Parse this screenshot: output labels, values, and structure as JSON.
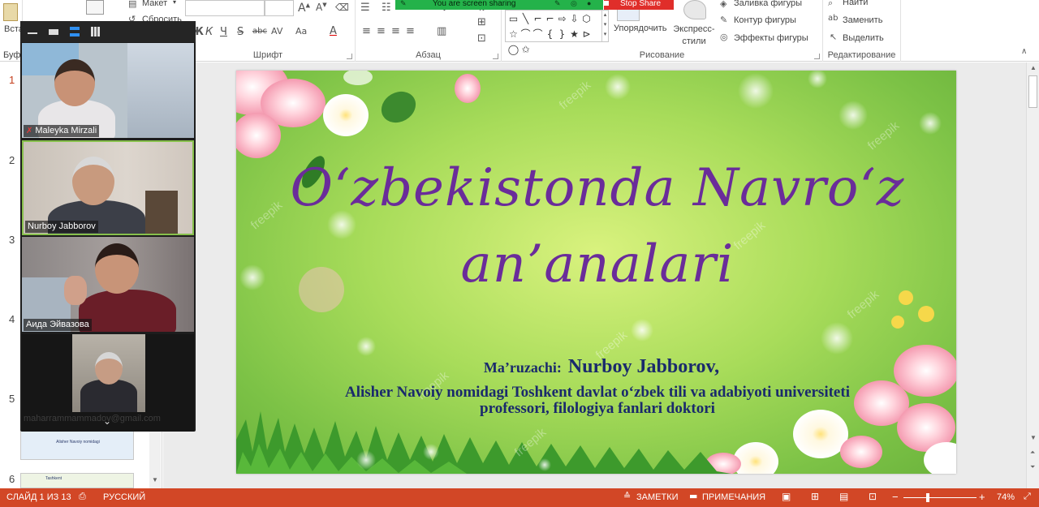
{
  "ribbon": {
    "clipboard": {
      "paste_label": "Вста",
      "group_label": "Буфе"
    },
    "slides": {
      "layout_label": "Макет",
      "reset_label": "Сбросить"
    },
    "font": {
      "group_label": "Шрифт",
      "buttons": [
        "Ж",
        "К",
        "Ч",
        "S",
        "abc",
        "AV",
        "Aa",
        "A"
      ]
    },
    "paragraph": {
      "group_label": "Абзац"
    },
    "drawing": {
      "group_label": "Рисование",
      "arrange_label": "Упорядочить",
      "quick_styles_label": "Экспресс-стили",
      "shape_fill_label": "Заливка фигуры",
      "shape_outline_label": "Контур фигуры",
      "shape_effects_label": "Эффекты фигуры",
      "shape_glyphs": [
        "▭",
        "╲",
        "⌐",
        "⌐",
        "⇨",
        "⇩",
        "⬡",
        "☆",
        "⌒",
        "⌒",
        "{",
        "}",
        "★",
        "⊳",
        "◯",
        "✩"
      ]
    },
    "editing": {
      "group_label": "Редактирование",
      "find_label": "Найти",
      "replace_label": "Заменить",
      "select_label": "Выделить"
    }
  },
  "share": {
    "status_text": "You are screen sharing",
    "stop_label": "Stop Share"
  },
  "thumbnails": {
    "numbers": [
      "1",
      "2",
      "3",
      "4",
      "5",
      "6"
    ],
    "thumb_texts": [
      "Alisher Navoiy nomidagi",
      "Tashkent"
    ]
  },
  "zoom": {
    "participants": [
      {
        "name": "Maleyka Mirzali",
        "muted": true
      },
      {
        "name": "Nurboy Jabborov",
        "muted": false
      },
      {
        "name": "Аида Эйвазова",
        "muted": false
      },
      {
        "name": "maharrammammadov@gmail.com",
        "muted": false
      }
    ]
  },
  "slide": {
    "title": "O‘zbekistonda  Navro‘z an’analari",
    "speaker_label": "Ma’ruzachi:",
    "speaker_name": "Nurboy Jabborov,",
    "affiliation": "Alisher Navoiy nomidagi Toshkent davlat o‘zbek tili va adabiyoti universiteti professori, filologiya fanlari doktori",
    "watermark": "freepik"
  },
  "status": {
    "slide_info": "СЛАЙД 1 ИЗ 13",
    "language": "РУССКИЙ",
    "notes_label": "ЗАМЕТКИ",
    "comments_label": "ПРИМЕЧАНИЯ",
    "zoom_minus": "−",
    "zoom_plus": "+",
    "zoom_level": "74%"
  },
  "colors": {
    "status_bar": "#d24726",
    "title_text": "#6a2c9a",
    "speaker_text": "#1a2a6c",
    "share_bar": "#24b24a",
    "stop_share": "#e02e2a"
  }
}
